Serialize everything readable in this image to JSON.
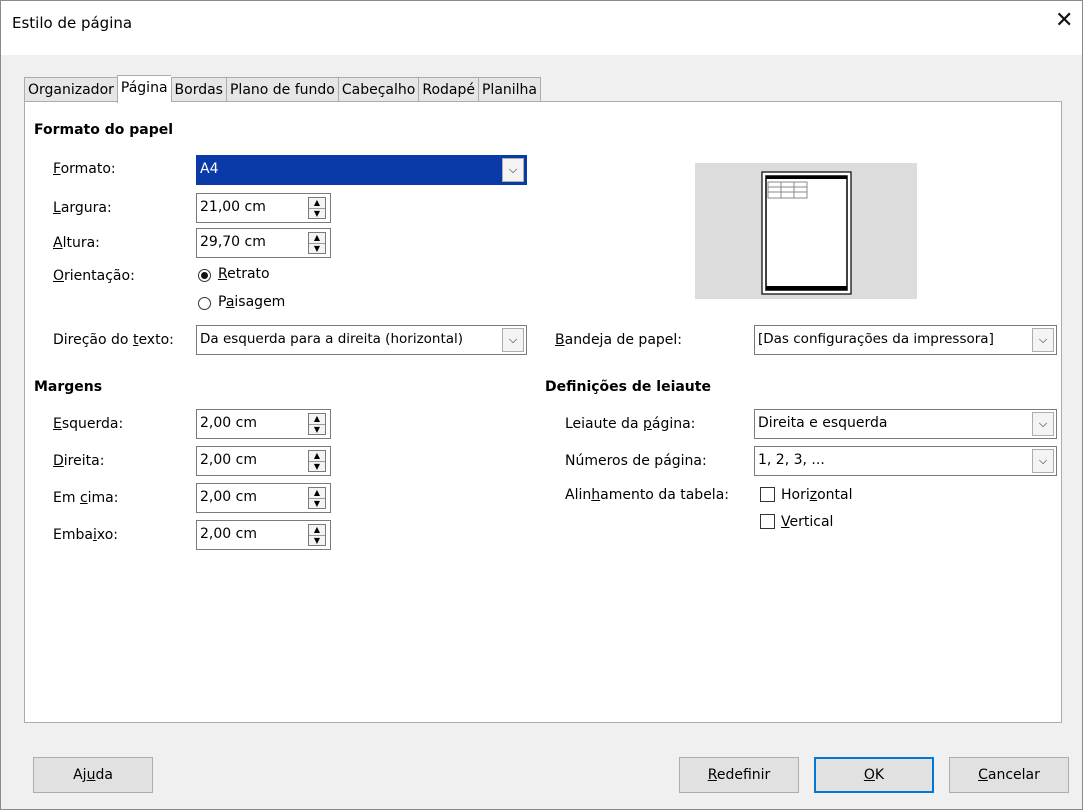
{
  "window": {
    "title": "Estilo de página",
    "close_glyph": "✕"
  },
  "tabs": [
    "Organizador",
    "Página",
    "Bordas",
    "Plano de fundo",
    "Cabeçalho",
    "Rodapé",
    "Planilha"
  ],
  "active_tab": "Página",
  "paper_format": {
    "heading": "Formato do papel",
    "format": {
      "label_u": "F",
      "label_rest": "ormato:",
      "value": "A4"
    },
    "width": {
      "label_u": "L",
      "label_rest": "argura:",
      "value": "21,00 cm"
    },
    "height": {
      "label_u": "A",
      "label_rest": "ltura:",
      "value": "29,70 cm"
    },
    "orientation": {
      "label_u": "O",
      "label_rest": "rientação:",
      "portrait_u": "R",
      "portrait_rest": "etrato",
      "landscape_pre": "P",
      "landscape_u": "a",
      "landscape_rest": "isagem",
      "selected": "portrait"
    },
    "text_direction": {
      "label_pre": "Direção do ",
      "label_u": "t",
      "label_rest": "exto:",
      "value": "Da esquerda para a direita (horizontal)"
    },
    "paper_tray": {
      "label_u": "B",
      "label_rest": "andeja de papel:",
      "value": "[Das configurações da impressora]"
    }
  },
  "margins": {
    "heading": "Margens",
    "left": {
      "label_u": "E",
      "label_rest": "squerda:",
      "value": "2,00 cm"
    },
    "right": {
      "label_u": "D",
      "label_rest": "ireita:",
      "value": "2,00 cm"
    },
    "top": {
      "label_pre": "Em ",
      "label_u": "c",
      "label_rest": "ima:",
      "value": "2,00 cm"
    },
    "bottom": {
      "label_pre": "Emba",
      "label_u": "i",
      "label_rest": "xo:",
      "value": "2,00 cm"
    }
  },
  "layout_settings": {
    "heading": "Definições de leiaute",
    "page_layout": {
      "label_pre": "Leiaute da ",
      "label_u": "p",
      "label_rest": "ágina:",
      "value": "Direita e esquerda"
    },
    "page_numbers": {
      "label": "Números de página:",
      "value": "1, 2, 3, ..."
    },
    "table_alignment": {
      "label_pre": "Alin",
      "label_u": "h",
      "label_rest": "amento da tabela:",
      "horizontal_pre": "Hori",
      "horizontal_u": "z",
      "horizontal_rest": "ontal",
      "vertical_u": "V",
      "vertical_rest": "ertical",
      "horizontal_checked": false,
      "vertical_checked": false
    }
  },
  "buttons": {
    "help_pre": "Aj",
    "help_u": "u",
    "help_rest": "da",
    "reset_u": "R",
    "reset_rest": "edefinir",
    "ok_u": "O",
    "ok_rest": "K",
    "cancel_u": "C",
    "cancel_rest": "ancelar"
  },
  "colors": {
    "selection": "#0a39a8",
    "default_button_border": "#0078d7"
  }
}
